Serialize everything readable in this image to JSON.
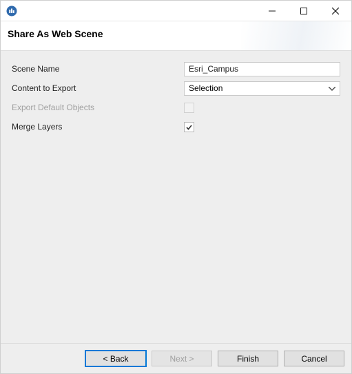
{
  "app": {
    "icon_name": "cityengine-icon",
    "accent": "#2f6aad"
  },
  "header": {
    "title": "Share As Web Scene"
  },
  "form": {
    "scene_name": {
      "label": "Scene Name",
      "value": "Esri_Campus"
    },
    "content_to_export": {
      "label": "Content to Export",
      "selected": "Selection"
    },
    "export_default_objects": {
      "label": "Export Default Objects",
      "checked": false,
      "enabled": false
    },
    "merge_layers": {
      "label": "Merge Layers",
      "checked": true,
      "enabled": true
    }
  },
  "footer": {
    "back": "< Back",
    "next": "Next >",
    "finish": "Finish",
    "cancel": "Cancel"
  }
}
